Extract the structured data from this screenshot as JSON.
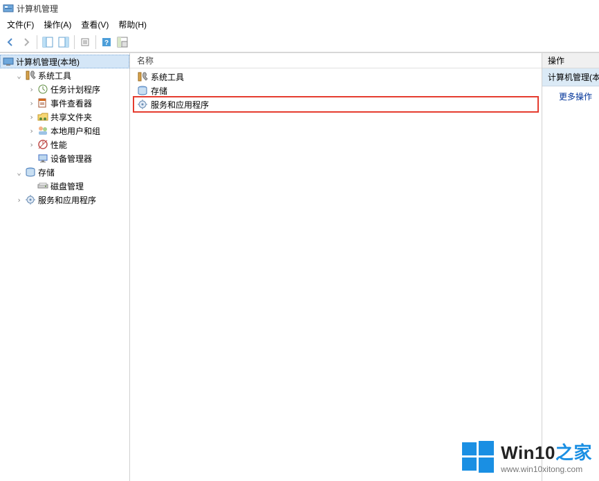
{
  "window": {
    "title": "计算机管理"
  },
  "menu": {
    "file": "文件(F)",
    "action": "操作(A)",
    "view": "查看(V)",
    "help": "帮助(H)"
  },
  "toolbar": {
    "back": "back-icon",
    "forward": "forward-icon",
    "up1": "show-hide-tree-icon",
    "up2": "export-icon",
    "props": "properties-icon",
    "refresh": "refresh-icon",
    "help": "help-icon",
    "extra": "extra-icon"
  },
  "tree": {
    "root": {
      "label": "计算机管理(本地)",
      "icon": "computer-management-icon"
    },
    "system_tools": {
      "label": "系统工具",
      "icon": "system-tools-icon",
      "children": [
        {
          "label": "任务计划程序",
          "icon": "task-scheduler-icon",
          "expandable": true
        },
        {
          "label": "事件查看器",
          "icon": "event-viewer-icon",
          "expandable": true
        },
        {
          "label": "共享文件夹",
          "icon": "shared-folders-icon",
          "expandable": true
        },
        {
          "label": "本地用户和组",
          "icon": "local-users-icon",
          "expandable": true
        },
        {
          "label": "性能",
          "icon": "performance-icon",
          "expandable": true
        },
        {
          "label": "设备管理器",
          "icon": "device-manager-icon",
          "expandable": false
        }
      ]
    },
    "storage": {
      "label": "存储",
      "icon": "storage-icon",
      "children": [
        {
          "label": "磁盘管理",
          "icon": "disk-management-icon",
          "expandable": false
        }
      ]
    },
    "services_apps": {
      "label": "服务和应用程序",
      "icon": "services-apps-icon",
      "expandable": true
    }
  },
  "list": {
    "header": "名称",
    "items": [
      {
        "label": "系统工具",
        "icon": "system-tools-icon"
      },
      {
        "label": "存储",
        "icon": "storage-icon"
      },
      {
        "label": "服务和应用程序",
        "icon": "services-apps-icon",
        "highlight": true
      }
    ]
  },
  "actions": {
    "header": "操作",
    "section": "计算机管理(本地)",
    "more": "更多操作"
  },
  "watermark": {
    "brand_prefix": "Win10",
    "brand_suffix": "之家",
    "url": "www.win10xitong.com"
  }
}
